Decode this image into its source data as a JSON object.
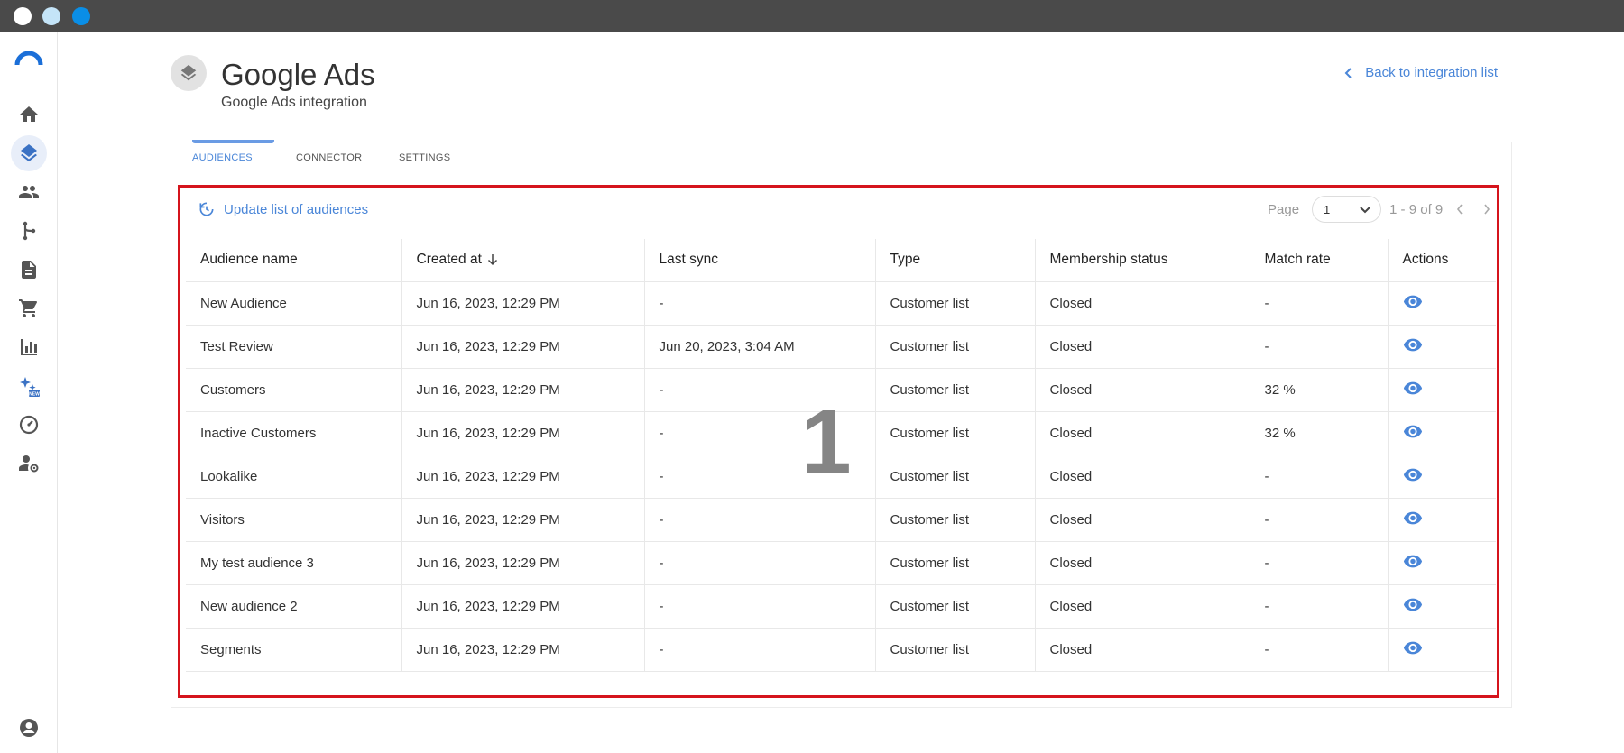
{
  "header": {
    "title": "Google Ads",
    "subtitle": "Google Ads integration",
    "back_label": "Back to integration list"
  },
  "sidebar": {
    "items": [
      {
        "icon": "home-icon"
      },
      {
        "icon": "layers-icon",
        "active": true
      },
      {
        "icon": "people-icon"
      },
      {
        "icon": "flow-icon"
      },
      {
        "icon": "document-icon"
      },
      {
        "icon": "cart-icon"
      },
      {
        "icon": "bar-chart-icon"
      },
      {
        "icon": "sparkles-new-icon",
        "badge": "NEW"
      },
      {
        "icon": "dashboard-icon"
      },
      {
        "icon": "user-settings-icon"
      }
    ],
    "bottom_icon": "account-icon"
  },
  "tabs": [
    {
      "label": "AUDIENCES",
      "active": true
    },
    {
      "label": "CONNECTOR",
      "active": false
    },
    {
      "label": "SETTINGS",
      "active": false
    }
  ],
  "toolbar": {
    "update_label": "Update list of audiences"
  },
  "pagination": {
    "page_label": "Page",
    "current_page": "1",
    "range_text": "1 - 9 of 9"
  },
  "table": {
    "columns": [
      "Audience name",
      "Created at",
      "Last sync",
      "Type",
      "Membership status",
      "Match rate",
      "Actions"
    ],
    "rows": [
      [
        "New Audience",
        "Jun 16, 2023, 12:29 PM",
        "-",
        "Customer list",
        "Closed",
        "-"
      ],
      [
        "Test Review",
        "Jun 16, 2023, 12:29 PM",
        "Jun 20, 2023, 3:04 AM",
        "Customer list",
        "Closed",
        "-"
      ],
      [
        "Customers",
        "Jun 16, 2023, 12:29 PM",
        "-",
        "Customer list",
        "Closed",
        "32 %"
      ],
      [
        "Inactive Customers",
        "Jun 16, 2023, 12:29 PM",
        "-",
        "Customer list",
        "Closed",
        "32 %"
      ],
      [
        "Lookalike",
        "Jun 16, 2023, 12:29 PM",
        "-",
        "Customer list",
        "Closed",
        "-"
      ],
      [
        "Visitors",
        "Jun 16, 2023, 12:29 PM",
        "-",
        "Customer list",
        "Closed",
        "-"
      ],
      [
        "My test audience 3",
        "Jun 16, 2023, 12:29 PM",
        "-",
        "Customer list",
        "Closed",
        "-"
      ],
      [
        "New audience 2",
        "Jun 16, 2023, 12:29 PM",
        "-",
        "Customer list",
        "Closed",
        "-"
      ],
      [
        "Segments",
        "Jun 16, 2023, 12:29 PM",
        "-",
        "Customer list",
        "Closed",
        "-"
      ]
    ]
  },
  "annotation": {
    "label": "1",
    "color": "#d5141c"
  },
  "colors": {
    "accent": "#4a86d8",
    "titlebar": "#4a4a4a"
  }
}
